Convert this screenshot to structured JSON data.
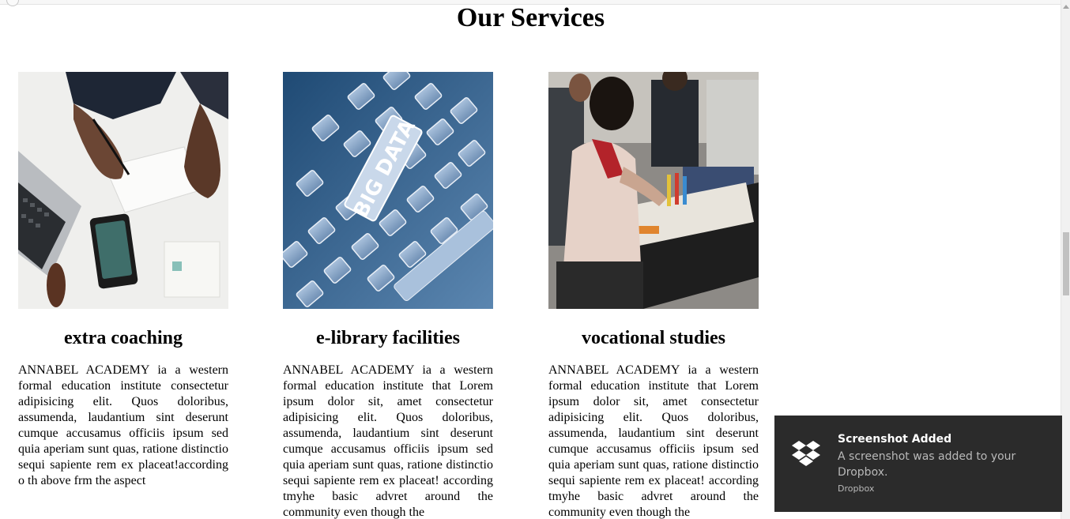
{
  "page": {
    "title": "Our Services"
  },
  "cards": [
    {
      "heading": "extra coaching",
      "text": "ANNABEL ACADEMY ia a western formal education institute consectetur adipisicing elit. Quos doloribus, assumenda, laudantium sint deserunt cumque accusamus officiis ipsum sed quia aperiam sunt quas, ratione distinctio sequi sapiente rem ex placeat!according o th above frm the aspect"
    },
    {
      "heading": "e-library facilities",
      "text": "ANNABEL ACADEMY ia a western formal education institute that Lorem ipsum dolor sit, amet consectetur adipisicing elit. Quos doloribus, assumenda, laudantium sint deserunt cumque accusamus officiis ipsum sed quia aperiam sunt quas, ratione distinctio sequi sapiente rem ex placeat! according tmyhe basic advret around the community even though the",
      "image_text": "BIG DATA"
    },
    {
      "heading": "vocational studies",
      "text": "ANNABEL ACADEMY ia a western formal education institute that Lorem ipsum dolor sit, amet consectetur adipisicing elit. Quos doloribus, assumenda, laudantium sint deserunt cumque accusamus officiis ipsum sed quia aperiam sunt quas, ratione distinctio sequi sapiente rem ex placeat! according tmyhe basic advret around the community even though the"
    }
  ],
  "toast": {
    "title": "Screenshot Added",
    "message": "A screenshot was added to your Dropbox.",
    "source": "Dropbox",
    "icon": "dropbox-icon"
  },
  "colors": {
    "toast_bg": "#2b2b2b",
    "library_blue": "#2f5d8a"
  }
}
